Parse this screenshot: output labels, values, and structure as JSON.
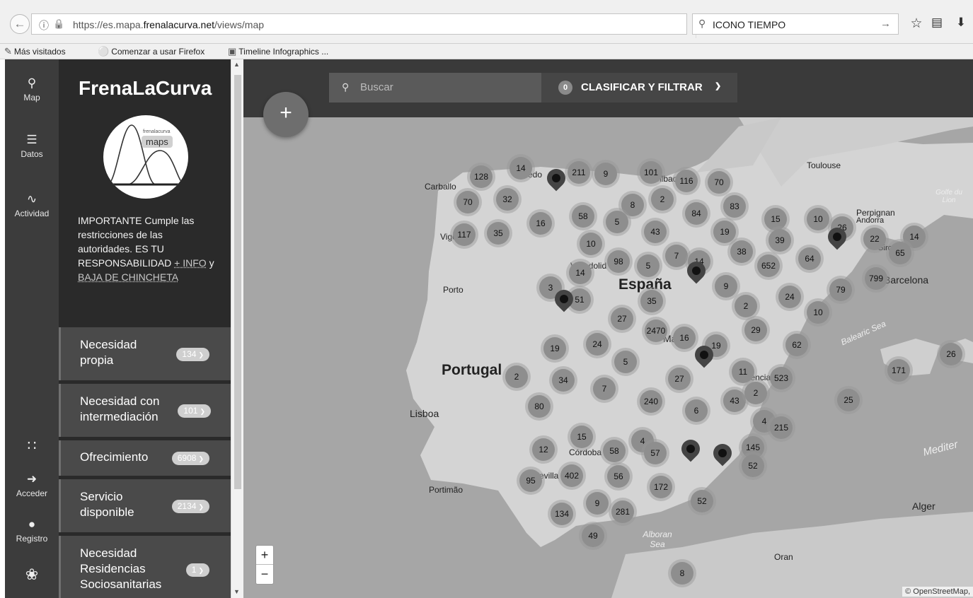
{
  "browser": {
    "url_prefix": "https://es.mapa.",
    "url_domain": "frenalacurva.net",
    "url_path": "/views/map",
    "search_query": "ICONO TIEMPO",
    "bookmarks": [
      "Más visitados",
      "Comenzar a usar Firefox",
      "Timeline Infographics ..."
    ]
  },
  "rail": {
    "map": "Map",
    "datos": "Datos",
    "actividad": "Actividad",
    "acceder": "Acceder",
    "registro": "Registro"
  },
  "sidebar": {
    "brand": "FrenaLaCurva",
    "logo_small": "frenalacurva",
    "logo_big": "maps",
    "notice_main": "IMPORTANTE Cumple las restricciones de las autoridades. ES TU RESPONSABILIDAD",
    "notice_plus": "+ INFO",
    "notice_y": "y",
    "notice_link": "BAJA DE CHINCHETA",
    "filters": [
      {
        "label": "Necesidad propia",
        "count": "134"
      },
      {
        "label": "Necesidad con intermediación",
        "count": "101"
      },
      {
        "label": "Ofrecimiento",
        "count": "6908"
      },
      {
        "label": "Servicio disponible",
        "count": "2134"
      },
      {
        "label": "Necesidad Residencias Sociosanitarias",
        "count": "1"
      }
    ]
  },
  "map": {
    "search_placeholder": "Buscar",
    "filter_count": "0",
    "filter_label": "CLASIFICAR Y FILTRAR",
    "attribution": "© OpenStreetMap,",
    "labels": {
      "carballo": "Carballo",
      "oviedo": "Oviedo",
      "bilbao": "Bilbao",
      "toulouse": "Toulouse",
      "perpignan": "Perpignan",
      "andorra": "Andorra",
      "vigo": "Vigo",
      "valladolid": "Valladolid",
      "girona": "Girona",
      "porto": "Porto",
      "espana": "España",
      "barcelona": "Barcelona",
      "madrid": "Madrid",
      "portugal": "Portugal",
      "valencia": "Valencia",
      "lisboa": "Lisboa",
      "cordoba": "Córdoba",
      "sevilla": "Sevilla",
      "portimao": "Portimão",
      "alger": "Alger",
      "oran": "Oran",
      "golfe": "Golfe du Lion",
      "balearic": "Balearic Sea",
      "alboran": "Alboran Sea",
      "mediter": "Mediter"
    },
    "clusters": [
      "128",
      "14",
      "211",
      "9",
      "101",
      "116",
      "70",
      "70",
      "32",
      "8",
      "2",
      "84",
      "83",
      "58",
      "5",
      "117",
      "35",
      "16",
      "43",
      "19",
      "15",
      "10",
      "26",
      "22",
      "14",
      "39",
      "65",
      "10",
      "98",
      "7",
      "14",
      "38",
      "652",
      "64",
      "14",
      "5",
      "3",
      "51",
      "35",
      "9",
      "24",
      "79",
      "799",
      "27",
      "2",
      "10",
      "2470",
      "16",
      "19",
      "29",
      "62",
      "19",
      "24",
      "5",
      "11",
      "523",
      "26",
      "2",
      "34",
      "27",
      "171",
      "7",
      "240",
      "43",
      "2",
      "80",
      "6",
      "4",
      "215",
      "25",
      "15",
      "4",
      "145",
      "12",
      "58",
      "57",
      "52",
      "402",
      "56",
      "172",
      "95",
      "9",
      "281",
      "52",
      "134",
      "49",
      "8"
    ]
  }
}
